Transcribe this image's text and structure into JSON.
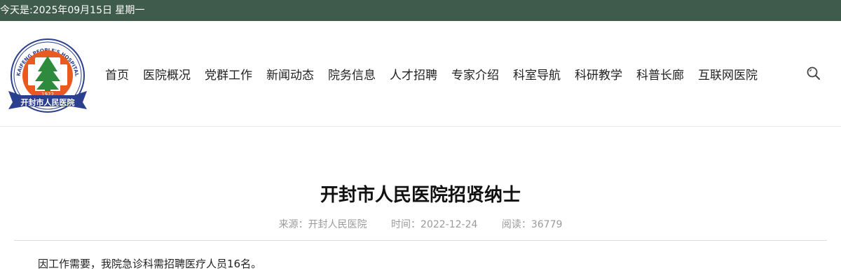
{
  "topbar": {
    "date_text": "今天是:2025年09月15日 星期一"
  },
  "logo": {
    "arc_text": "KAIFENG PEOPLE'S HOSPITAL",
    "ribbon_text": "开封市人民医院",
    "year": "1922",
    "colors": {
      "ring": "#e85a1f",
      "ribbon": "#2b3f8f",
      "tree": "#2e8b3e"
    }
  },
  "nav": {
    "items": [
      "首页",
      "医院概况",
      "党群工作",
      "新闻动态",
      "院务信息",
      "人才招聘",
      "专家介绍",
      "科室导航",
      "科研教学",
      "科普长廊",
      "互联网医院"
    ],
    "search_icon": "search-icon"
  },
  "article": {
    "title": "开封市人民医院招贤纳士",
    "source": "来源：开封人民医院",
    "time": "时间：2022-12-24",
    "views": "阅读：36779",
    "paragraph": "因工作需要，我院急诊科需招聘医疗人员16名。"
  }
}
